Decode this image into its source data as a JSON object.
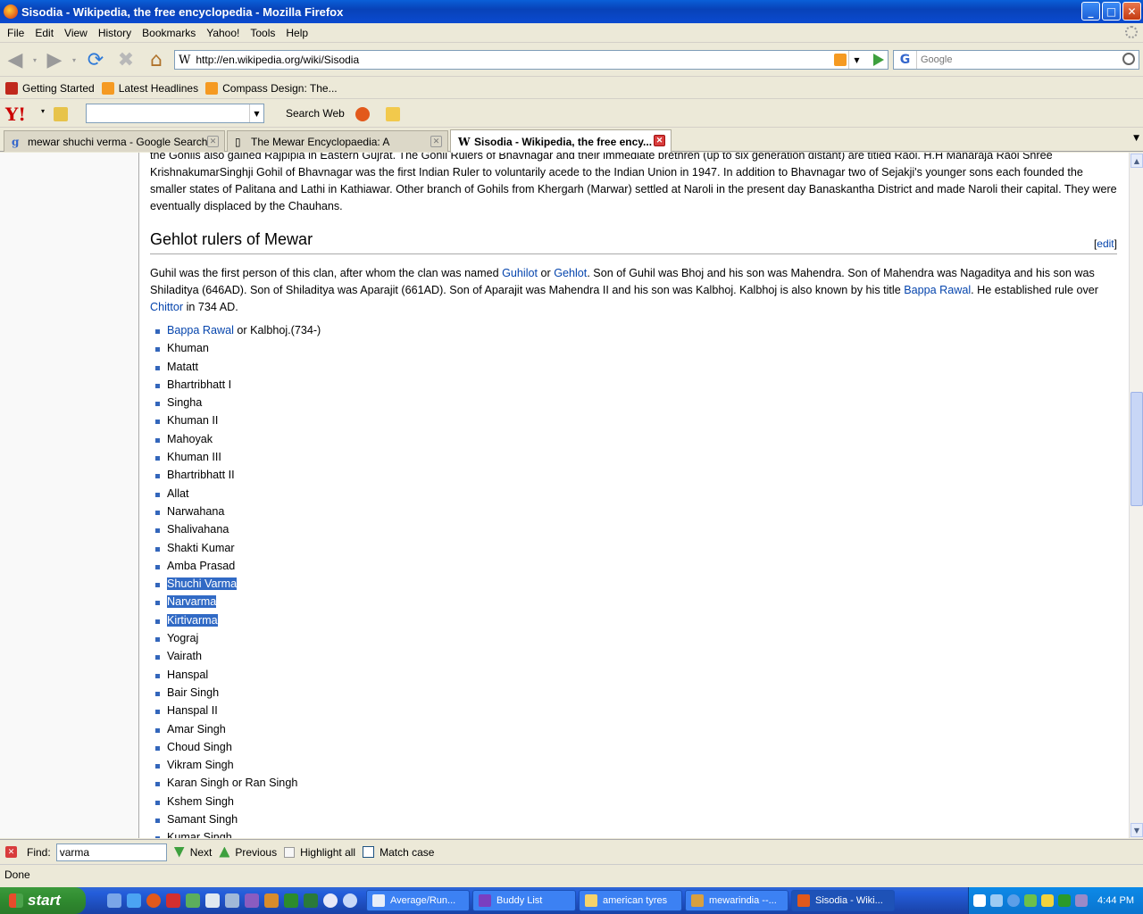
{
  "window": {
    "title": "Sisodia - Wikipedia, the free encyclopedia - Mozilla Firefox",
    "min": "_",
    "max": "□",
    "close": "✕"
  },
  "menu": [
    "File",
    "Edit",
    "View",
    "History",
    "Bookmarks",
    "Yahoo!",
    "Tools",
    "Help"
  ],
  "nav": {
    "url": "http://en.wikipedia.org/wiki/Sisodia",
    "search_placeholder": "Google"
  },
  "bookmarks": [
    {
      "label": "Getting Started",
      "color": "#c0281c"
    },
    {
      "label": "Latest Headlines",
      "color": "#f59a22"
    },
    {
      "label": "Compass Design: The...",
      "color": "#f59a22"
    }
  ],
  "yahoo": {
    "logo": "Y!",
    "search_web": "Search Web"
  },
  "tabs": [
    {
      "label": "mewar shuchi verma - Google Search",
      "icon": "g"
    },
    {
      "label": "The Mewar Encyclopaedia: A",
      "icon": "▯"
    },
    {
      "label": "Sisodia - Wikipedia, the free ency...",
      "icon": "W",
      "active": true
    }
  ],
  "article": {
    "top_para": "the Gohils also gained Rajpipla in Eastern Gujrat. The Gohil Rulers of Bhavnagar and their immediate brethren (up to six generation distant) are titled Raol. H.H Maharaja Raol Shree KrishnakumarSinghji Gohil of Bhavnagar was the first Indian Ruler to voluntarily acede to the Indian Union in 1947. In addition to Bhavnagar two of Sejakji's younger sons each founded the smaller states of Palitana and Lathi in Kathiawar. Other branch of Gohils from Khergarh (Marwar) settled at Naroli in the present day Banaskantha District and made Naroli their capital. They were eventually displaced by the Chauhans.",
    "heading": "Gehlot rulers of Mewar",
    "edit": "edit",
    "intro": {
      "t1": "Guhil was the first person of this clan, after whom the clan was named ",
      "l1": "Guhilot",
      "t2": " or ",
      "l2": "Gehlot",
      "t3": ". Son of Guhil was Bhoj and his son was Mahendra. Son of Mahendra was Nagaditya and his son was Shiladitya (646AD). Son of Shiladitya was Aparajit (661AD). Son of Aparajit was Mahendra II and his son was Kalbhoj. Kalbhoj is also known by his title ",
      "l3": "Bappa Rawal",
      "t4": ". He established rule over ",
      "l4": "Chittor",
      "t5": " in 734 AD."
    },
    "first_ruler": {
      "link": "Bappa Rawal",
      "rest": " or Kalbhoj.(734-)"
    },
    "rulers": [
      "Khuman",
      "Matatt",
      "Bhartribhatt I",
      "Singha",
      "Khuman II",
      "Mahoyak",
      "Khuman III",
      "Bhartribhatt II",
      "Allat",
      "Narwahana",
      "Shalivahana",
      "Shakti Kumar",
      "Amba Prasad",
      "Shuchi Varma",
      "Narvarma",
      "Kirtivarma",
      "Yograj",
      "Vairath",
      "Hanspal",
      "Bair Singh",
      "Hanspal II",
      "Amar Singh",
      "Choud Singh",
      "Vikram Singh",
      "Karan Singh or Ran Singh",
      "Kshem Singh",
      "Samant Singh",
      "Kumar Singh"
    ],
    "highlighted": [
      "Shuchi Varma",
      "Narvarma",
      "Kirtivarma"
    ]
  },
  "find": {
    "label": "Find:",
    "value": "varma",
    "next": "Next",
    "previous": "Previous",
    "highlight": "Highlight all",
    "match_case": "Match case"
  },
  "status": "Done",
  "taskbar": {
    "start": "start",
    "tasks": [
      {
        "label": "Average/Run...",
        "color": "#e8eef8"
      },
      {
        "label": "Buddy List",
        "color": "#7a3fc0"
      },
      {
        "label": "american tyres",
        "color": "#f5d36b"
      },
      {
        "label": "mewarindia --...",
        "color": "#d8a040"
      },
      {
        "label": "Sisodia - Wiki...",
        "color": "#e2591b",
        "active": true
      }
    ],
    "clock": "4:44 PM"
  }
}
